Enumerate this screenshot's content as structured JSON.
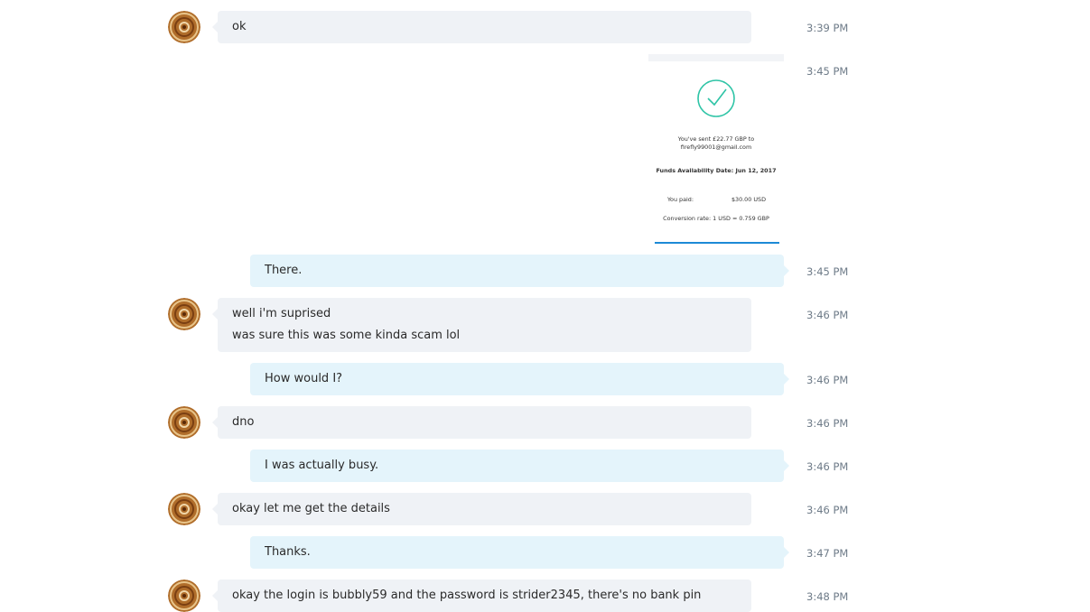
{
  "messages": [
    {
      "from": "contact",
      "lines": [
        "ok"
      ],
      "time": "3:39 PM"
    },
    {
      "from": "me",
      "type": "image",
      "time": "3:45 PM",
      "receipt": {
        "sent_text": "You've sent £22.77 GBP to firefly99001@gmail.com",
        "funds_text": "Funds Availability Date: Jun 12, 2017",
        "paid_label": "You paid:",
        "paid_value": "$30.00 USD",
        "conversion_text": "Conversion rate: 1 USD = 0.759 GBP",
        "check_color": "#2ec4a6"
      }
    },
    {
      "from": "me",
      "lines": [
        "There."
      ],
      "time": "3:45 PM"
    },
    {
      "from": "contact",
      "lines": [
        "well i'm suprised",
        "was sure this was some kinda scam lol"
      ],
      "time": "3:46 PM"
    },
    {
      "from": "me",
      "lines": [
        "How would I?"
      ],
      "time": "3:46 PM"
    },
    {
      "from": "contact",
      "lines": [
        "dno"
      ],
      "time": "3:46 PM"
    },
    {
      "from": "me",
      "lines": [
        "I was actually busy."
      ],
      "time": "3:46 PM"
    },
    {
      "from": "contact",
      "lines": [
        "okay let me get the details"
      ],
      "time": "3:46 PM"
    },
    {
      "from": "me",
      "lines": [
        "Thanks."
      ],
      "time": "3:47 PM"
    },
    {
      "from": "contact",
      "lines": [
        "okay the login is bubbly59 and the password is strider2345, there's no bank pin"
      ],
      "time": "3:48 PM"
    }
  ],
  "colors": {
    "incoming_bubble": "#eff2f6",
    "outgoing_bubble": "#e4f4fb",
    "timestamp": "#6e7b88"
  },
  "icons": {
    "avatar": "cinnamon-roll-avatar-icon",
    "receipt_check": "checkmark-circle-icon"
  }
}
